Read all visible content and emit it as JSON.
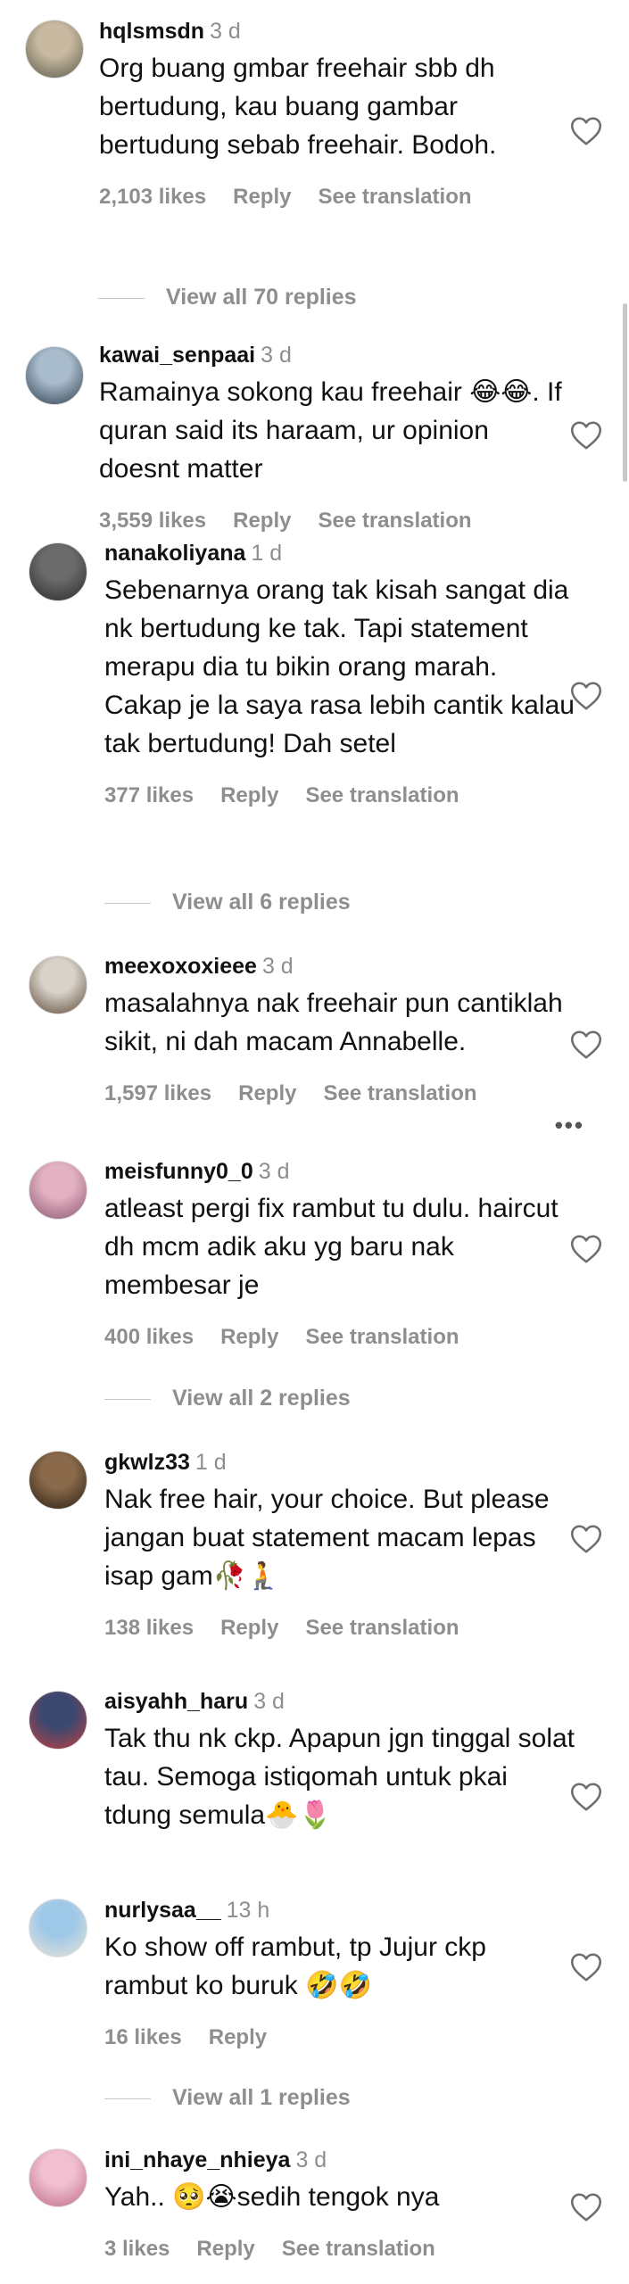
{
  "icons": {
    "like": "heart-outline-icon",
    "more": "more-horizontal-icon"
  },
  "labels": {
    "reply": "Reply",
    "see_translation": "See translation"
  },
  "comments": [
    {
      "username": "hqlsmsdn",
      "time": "3 d",
      "text": "Org buang gmbar freehair sbb dh bertudung, kau buang gambar bertudung sebab freehair. Bodoh.",
      "likes": "2,103 likes",
      "view_replies": "View all 70 replies",
      "avatar_colors": [
        "#c9b9a0",
        "#5a5a4c"
      ]
    },
    {
      "username": "kawai_senpaai",
      "time": "3 d",
      "text": "Ramainya sokong kau freehair 😂😂. If quran said its haraam, ur opinion doesnt matter",
      "likes": "3,559 likes",
      "avatar_colors": [
        "#a9bccc",
        "#2e3d4d"
      ]
    },
    {
      "username": "nanakoliyana",
      "time": "1 d",
      "text": "Sebenarnya orang tak kisah sangat dia nk bertudung ke tak. Tapi statement merapu dia tu bikin orang marah. Cakap je la saya rasa lebih cantik kalau tak bertudung! Dah setel",
      "likes": "377 likes",
      "view_replies": "View all 6 replies",
      "avatar_colors": [
        "#6b6b6b",
        "#2b2b2b"
      ]
    },
    {
      "username": "meexoxoxieee",
      "time": "3 d",
      "text": "masalahnya nak freehair pun cantiklah sikit, ni dah macam Annabelle.",
      "likes": "1,597 likes",
      "more": "•••",
      "avatar_colors": [
        "#d8d2c8",
        "#5e4a3a"
      ]
    },
    {
      "username": "meisfunny0_0",
      "time": "3 d",
      "text": "atleast pergi fix rambut tu dulu. haircut dh mcm adik aku yg baru nak membesar je",
      "likes": "400 likes",
      "view_replies": "View all 2 replies",
      "avatar_colors": [
        "#e3b2c2",
        "#8a5570"
      ]
    },
    {
      "username": "gkwlz33",
      "time": "1 d",
      "text": "Nak free hair, your choice. But please jangan buat statement macam lepas isap gam🥀🧎",
      "likes": "138 likes",
      "avatar_colors": [
        "#8a6a4a",
        "#2a2015"
      ]
    },
    {
      "username": "aisyahh_haru",
      "time": "3 d",
      "text": "Tak thu nk ckp. Apapun jgn tinggal solat tau. Semoga istiqomah untuk pkai tdung semula🐣🌷",
      "avatar_colors": [
        "#3a4870",
        "#c04040"
      ]
    },
    {
      "username": "nurlysaa__",
      "time": "13 h",
      "text": "Ko show off rambut, tp Jujur ckp rambut ko buruk 🤣🤣",
      "likes": "16 likes",
      "view_replies": "View all 1 replies",
      "avatar_colors": [
        "#9ec8e8",
        "#e8e2d6"
      ]
    },
    {
      "username": "ini_nhaye_nhieya",
      "time": "3 d",
      "text": "Yah.. 🥺😭sedih tengok nya",
      "likes": "3 likes",
      "avatar_colors": [
        "#f0c0d0",
        "#c06a8a"
      ]
    }
  ]
}
